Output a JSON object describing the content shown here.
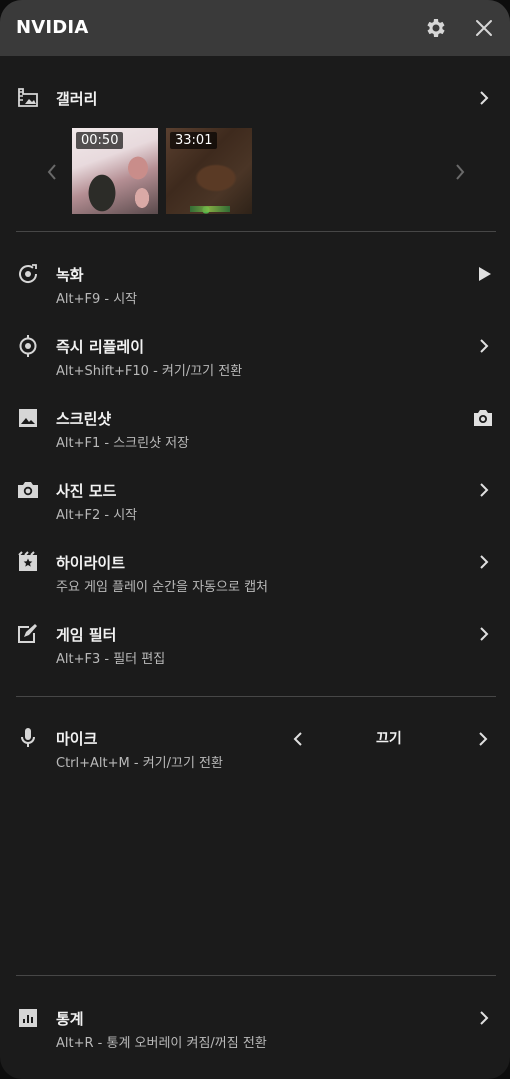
{
  "header": {
    "title": "NVIDIA",
    "settings_icon": "gear-icon",
    "close_icon": "close-icon"
  },
  "gallery": {
    "title": "갤러리",
    "icon": "gallery-icon",
    "thumbnails": [
      {
        "duration": "00:50"
      },
      {
        "duration": "33:01"
      }
    ]
  },
  "items": [
    {
      "id": "record",
      "title": "녹화",
      "subtitle": "Alt+F9 - 시작",
      "icon": "record-icon",
      "action": "play-icon"
    },
    {
      "id": "instant-replay",
      "title": "즉시 리플레이",
      "subtitle": "Alt+Shift+F10 - 켜기/끄기 전환",
      "icon": "instant-replay-icon",
      "action": "chevron-right-icon"
    },
    {
      "id": "screenshot",
      "title": "스크린샷",
      "subtitle": "Alt+F1 - 스크린샷 저장",
      "icon": "image-icon",
      "action": "camera-icon"
    },
    {
      "id": "photo-mode",
      "title": "사진 모드",
      "subtitle": "Alt+F2 - 시작",
      "icon": "camera-icon",
      "action": "chevron-right-icon"
    },
    {
      "id": "highlights",
      "title": "하이라이트",
      "subtitle": "주요 게임 플레이 순간을 자동으로 캡처",
      "icon": "highlight-icon",
      "action": "chevron-right-icon"
    },
    {
      "id": "game-filter",
      "title": "게임 필터",
      "subtitle": "Alt+F3 - 필터 편집",
      "icon": "filter-edit-icon",
      "action": "chevron-right-icon"
    }
  ],
  "mic": {
    "title": "마이크",
    "subtitle": "Ctrl+Alt+M - 켜기/끄기 전환",
    "value": "끄기",
    "icon": "microphone-icon"
  },
  "stats": {
    "title": "통계",
    "subtitle": "Alt+R - 통계 오버레이 켜짐/꺼짐 전환",
    "icon": "stats-icon"
  },
  "colors": {
    "panel": "#1b1b1b",
    "header": "#3a3a3a",
    "divider": "#474747",
    "subtext": "#b9b9b9"
  }
}
